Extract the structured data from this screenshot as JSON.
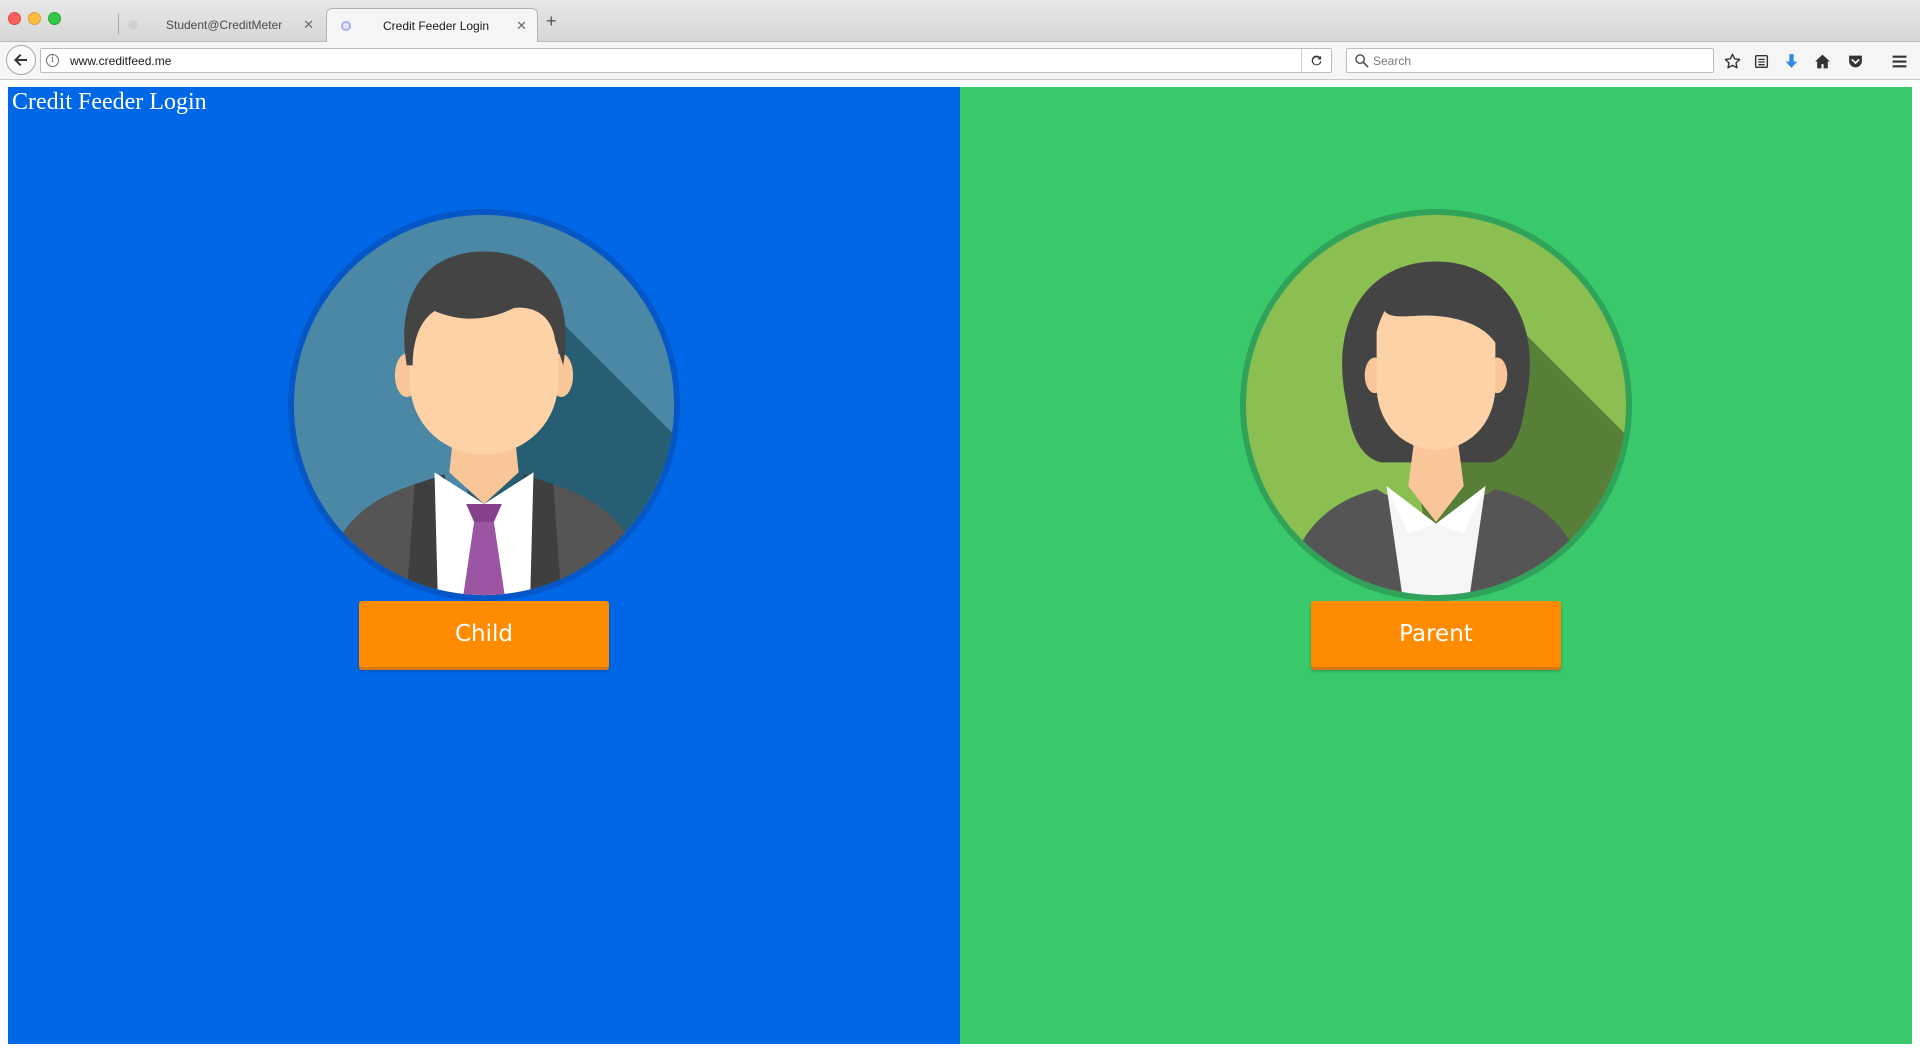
{
  "browser": {
    "tabs": [
      {
        "label": "Student@CreditMeter",
        "active": false
      },
      {
        "label": "Credit Feeder Login",
        "active": true
      }
    ],
    "url": "www.creditfeed.me",
    "search": {
      "placeholder": "Search"
    }
  },
  "page": {
    "title": "Credit Feeder Login",
    "left_panel": {
      "color": "#0068e6",
      "button_label": "Child",
      "avatar_icon": "businessman-avatar-icon"
    },
    "right_panel": {
      "color": "#3ac96a",
      "button_label": "Parent",
      "avatar_icon": "businesswoman-avatar-icon"
    },
    "button_color": "#ff8c00"
  }
}
